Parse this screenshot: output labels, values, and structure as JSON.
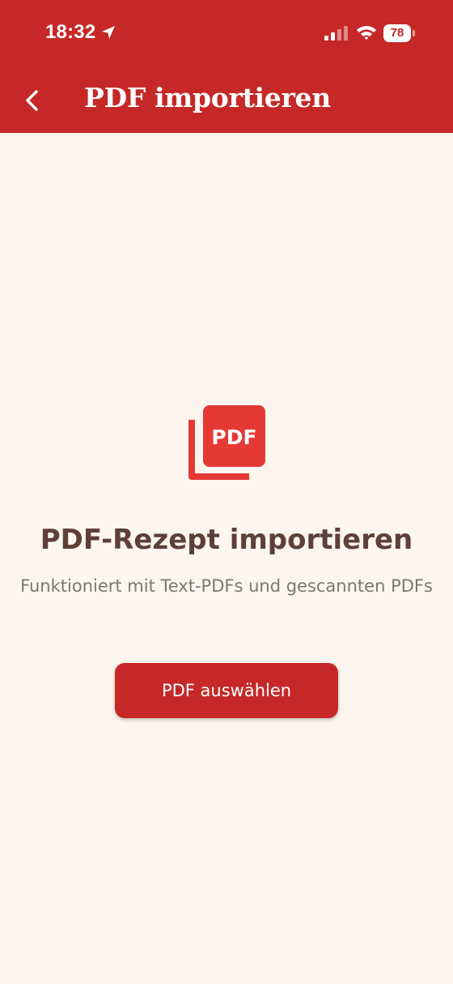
{
  "status_bar": {
    "time": "18:32",
    "battery_level": "78",
    "location_icon": "location-arrow-icon",
    "signal_icon": "cellular-signal-icon",
    "wifi_icon": "wifi-icon"
  },
  "header": {
    "back_icon": "chevron-left-icon",
    "title": "PDF importieren",
    "background_color": "#c62828"
  },
  "empty_state": {
    "icon": "pdf-file-icon",
    "icon_label": "PDF",
    "icon_color": "#e53935",
    "title": "PDF-Rezept importieren",
    "subtitle": "Funktioniert mit Text-PDFs und gescannten PDFs",
    "title_color": "#5d4037"
  },
  "actions": {
    "select_pdf_label": "PDF auswählen",
    "button_color": "#c62828"
  },
  "theme": {
    "background": "#fcf6ee",
    "accent": "#c62828"
  }
}
